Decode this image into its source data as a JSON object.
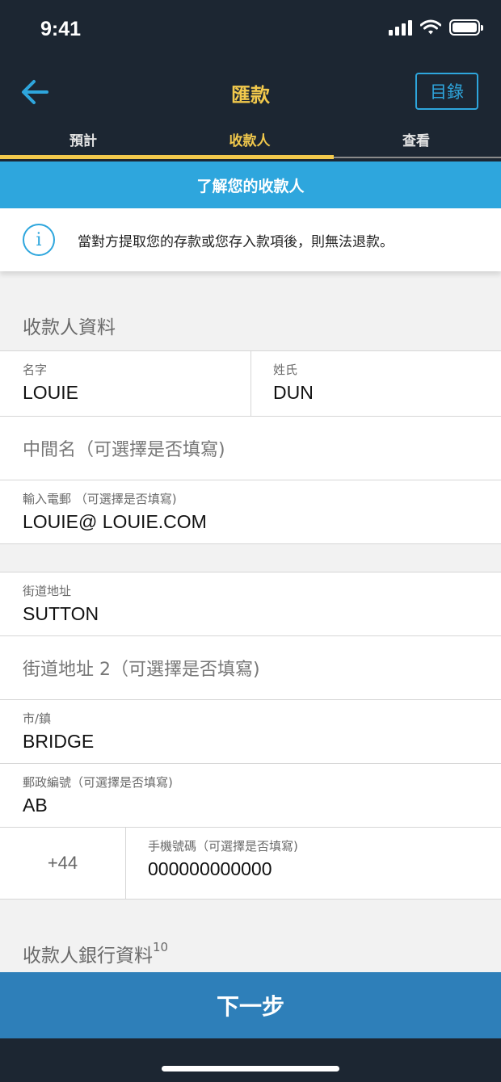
{
  "status_bar": {
    "time": "9:41"
  },
  "header": {
    "title": "匯款",
    "directory_label": "目錄",
    "tabs": [
      {
        "label": "預計",
        "active": false
      },
      {
        "label": "收款人",
        "active": true
      },
      {
        "label": "查看",
        "active": false
      }
    ]
  },
  "banner": {
    "text": "了解您的收款人"
  },
  "notice": {
    "icon": "info-icon",
    "text": "當對方提取您的存款或您存入款項後，則無法退款。"
  },
  "recipient": {
    "section_title": "收款人資料",
    "first_name": {
      "label": "名字",
      "value": "LOUIE"
    },
    "last_name": {
      "label": "姓氏",
      "value": "DUN"
    },
    "middle_name": {
      "placeholder": "中間名（可選擇是否填寫)"
    },
    "email": {
      "label": "輸入電郵 （可選擇是否填寫)",
      "value": "LOUIE@ LOUIE.COM"
    },
    "street": {
      "label": "街道地址",
      "value": "SUTTON"
    },
    "street2": {
      "placeholder": "街道地址 2（可選擇是否填寫)"
    },
    "city": {
      "label": "市/鎮",
      "value": "BRIDGE"
    },
    "postcode": {
      "label": "郵政編號（可選擇是否填寫)",
      "value": "AB"
    },
    "phone_code": "+44",
    "phone": {
      "label": "手機號碼（可選擇是否填寫)",
      "value": "000000000000"
    }
  },
  "bank": {
    "section_title": "收款人銀行資料",
    "footnote": "10"
  },
  "footer": {
    "next_label": "下一步"
  },
  "colors": {
    "header_bg": "#1c2632",
    "accent_yellow": "#f2c94c",
    "accent_blue": "#2ea6dd",
    "button_blue": "#2e7fb9"
  }
}
